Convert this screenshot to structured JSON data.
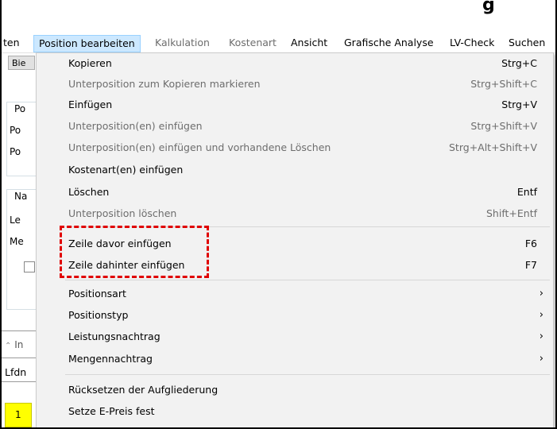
{
  "title_fragment": "g",
  "menubar": {
    "items": [
      {
        "label": "ten",
        "state": "normal"
      },
      {
        "label": "Position bearbeiten",
        "state": "active"
      },
      {
        "label": "Kalkulation",
        "state": "gray"
      },
      {
        "label": "Kostenart",
        "state": "gray"
      },
      {
        "label": "Ansicht",
        "state": "normal"
      },
      {
        "label": "Grafische Analyse",
        "state": "normal"
      },
      {
        "label": "LV-Check",
        "state": "normal"
      },
      {
        "label": "Suchen",
        "state": "normal"
      }
    ]
  },
  "background": {
    "button_label": "Bie",
    "labels": [
      "Po",
      "Po",
      "Po",
      "Na",
      "Le",
      "Me"
    ],
    "collapse_label": "In",
    "column_header": "Lfdn",
    "row_number": "1"
  },
  "menu": {
    "items": [
      {
        "label": "Kopieren",
        "shortcut": "Strg+C",
        "enabled": true
      },
      {
        "label": "Unterposition zum Kopieren markieren",
        "shortcut": "Strg+Shift+C",
        "enabled": false
      },
      {
        "label": "Einfügen",
        "shortcut": "Strg+V",
        "enabled": true
      },
      {
        "label": "Unterposition(en) einfügen",
        "shortcut": "Strg+Shift+V",
        "enabled": false
      },
      {
        "label": "Unterposition(en) einfügen und vorhandene Löschen",
        "shortcut": "Strg+Alt+Shift+V",
        "enabled": false
      },
      {
        "label": "Kostenart(en) einfügen",
        "shortcut": "",
        "enabled": true
      },
      {
        "label": "Löschen",
        "shortcut": "Entf",
        "enabled": true
      },
      {
        "label": "Unterposition löschen",
        "shortcut": "Shift+Entf",
        "enabled": false
      },
      {
        "label": "Zeile davor einfügen",
        "shortcut": "F6",
        "enabled": true
      },
      {
        "label": "Zeile dahinter einfügen",
        "shortcut": "F7",
        "enabled": true
      },
      {
        "label": "Positionsart",
        "submenu": true,
        "enabled": true
      },
      {
        "label": "Positionstyp",
        "submenu": true,
        "enabled": true
      },
      {
        "label": "Leistungsnachtrag",
        "submenu": true,
        "enabled": true
      },
      {
        "label": "Mengennachtrag",
        "submenu": true,
        "enabled": true
      },
      {
        "label": "Rücksetzen der Aufgliederung",
        "shortcut": "",
        "enabled": true
      },
      {
        "label": "Setze E-Preis fest",
        "shortcut": "",
        "enabled": true
      }
    ],
    "submenu_arrow": "›"
  },
  "annotation": {
    "color": "#e00000"
  },
  "colors": {
    "menu_bg": "#f2f2f2",
    "active_bg": "#cce8ff",
    "disabled_text": "#6d6d6d",
    "row_highlight": "#ffff00"
  }
}
